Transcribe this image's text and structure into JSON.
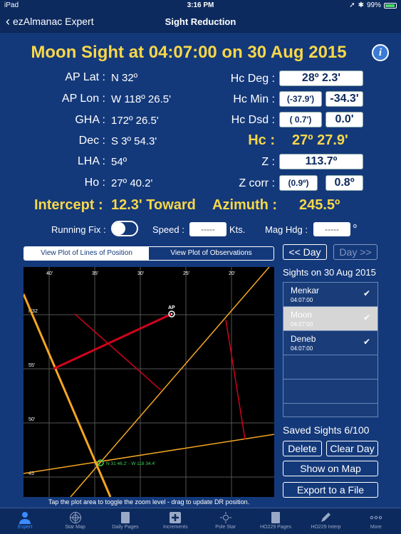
{
  "status": {
    "device": "iPad",
    "time": "3:16 PM",
    "battery": "99%"
  },
  "nav": {
    "back_label": "ezAlmanac Expert",
    "title": "Sight Reduction"
  },
  "headline": "Moon Sight at 04:07:00 on 30 Aug 2015",
  "fields": {
    "ap_lat_label": "AP Lat :",
    "ap_lat": "N 32º",
    "ap_lon_label": "AP Lon :",
    "ap_lon": "W 118º 26.5'",
    "gha_label": "GHA :",
    "gha": "172º 26.5'",
    "dec_label": "Dec :",
    "dec": "S 3º 54.3'",
    "lha_label": "LHA :",
    "lha": "54º",
    "ho_label": "Ho :",
    "ho": "27º 40.2'",
    "hc_deg_label": "Hc Deg :",
    "hc_deg": "28º  2.3'",
    "hc_min_label": "Hc Min :",
    "hc_min_a": "(-37.9')",
    "hc_min_b": "-34.3'",
    "hc_dsd_label": "Hc Dsd :",
    "hc_dsd_a": "( 0.7')",
    "hc_dsd_b": "0.0'",
    "hc_label": "Hc :",
    "hc": "27º 27.9'",
    "z_label": "Z :",
    "z": "113.7º",
    "zcorr_label": "Z corr :",
    "zcorr_a": "(0.9º)",
    "zcorr_b": "0.8º",
    "intercept_label": "Intercept :",
    "intercept": "12.3' Toward",
    "azimuth_label": "Azimuth :",
    "azimuth": "245.5º"
  },
  "controls": {
    "running_fix_label": "Running Fix :",
    "running_fix_on": false,
    "speed_label": "Speed :",
    "speed_value": "-----",
    "speed_unit": "Kts.",
    "mag_hdg_label": "Mag Hdg :",
    "mag_hdg_value": "-----",
    "mag_hdg_unit": "º"
  },
  "plot_tabs": {
    "lop": "View Plot of Lines of Position",
    "obs": "View Plot of Observations",
    "selected": "lop"
  },
  "day_nav": {
    "prev": "<< Day",
    "next": "Day >>"
  },
  "plot": {
    "top_ticks": [
      "40'",
      "35'",
      "30'",
      "25'",
      "20'"
    ],
    "left_ticks": [
      "N32",
      "55'",
      "50'",
      "45'"
    ],
    "ap_label": "AP",
    "fix_label": "N 31 46.2' - W 118 34.4'",
    "caption": "Tap the plot area to toggle the zoom level - drag to update DR position."
  },
  "sights": {
    "title": "Sights on 30 Aug 2015",
    "items": [
      {
        "name": "Menkar",
        "time": "04:07:00",
        "checked": true,
        "selected": false
      },
      {
        "name": "Moon",
        "time": "04:07:00",
        "checked": true,
        "selected": true
      },
      {
        "name": "Deneb",
        "time": "04:07:00",
        "checked": true,
        "selected": false
      }
    ]
  },
  "saved": "Saved Sights 6/100",
  "buttons": {
    "delete": "Delete",
    "clear_day": "Clear Day",
    "show_map": "Show on Map",
    "export": "Export to a File"
  },
  "tabs": [
    "Expert",
    "Star Map",
    "Daily Pages",
    "Increments",
    "Pole Star",
    "HO229 Pages",
    "HO229 Interp",
    "More"
  ],
  "colors": {
    "bg": "#14397a",
    "accent_yellow": "#f8d749",
    "lop_orange": "#f5a623",
    "intercept_red": "#d0021b",
    "fix_green": "#39d353"
  }
}
